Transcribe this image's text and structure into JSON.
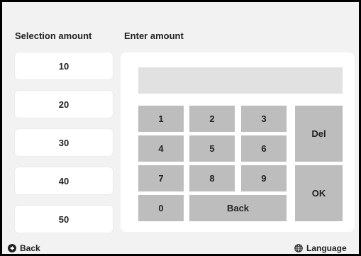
{
  "headers": {
    "selection": "Selection amount",
    "enter": "Enter amount"
  },
  "amounts": [
    "10",
    "20",
    "30",
    "40",
    "50"
  ],
  "display": {
    "value": ""
  },
  "keypad": {
    "k1": "1",
    "k2": "2",
    "k3": "3",
    "k4": "4",
    "k5": "5",
    "k6": "6",
    "k7": "7",
    "k8": "8",
    "k9": "9",
    "k0": "0",
    "back": "Back",
    "del": "Del",
    "ok": "OK"
  },
  "footer": {
    "back": "Back",
    "language": "Language"
  },
  "icons": {
    "back": "back-arrow-icon",
    "language": "globe-icon"
  },
  "colors": {
    "key": "#bdbdbd",
    "display": "#e1e1e1",
    "background": "#f2f2f2"
  }
}
